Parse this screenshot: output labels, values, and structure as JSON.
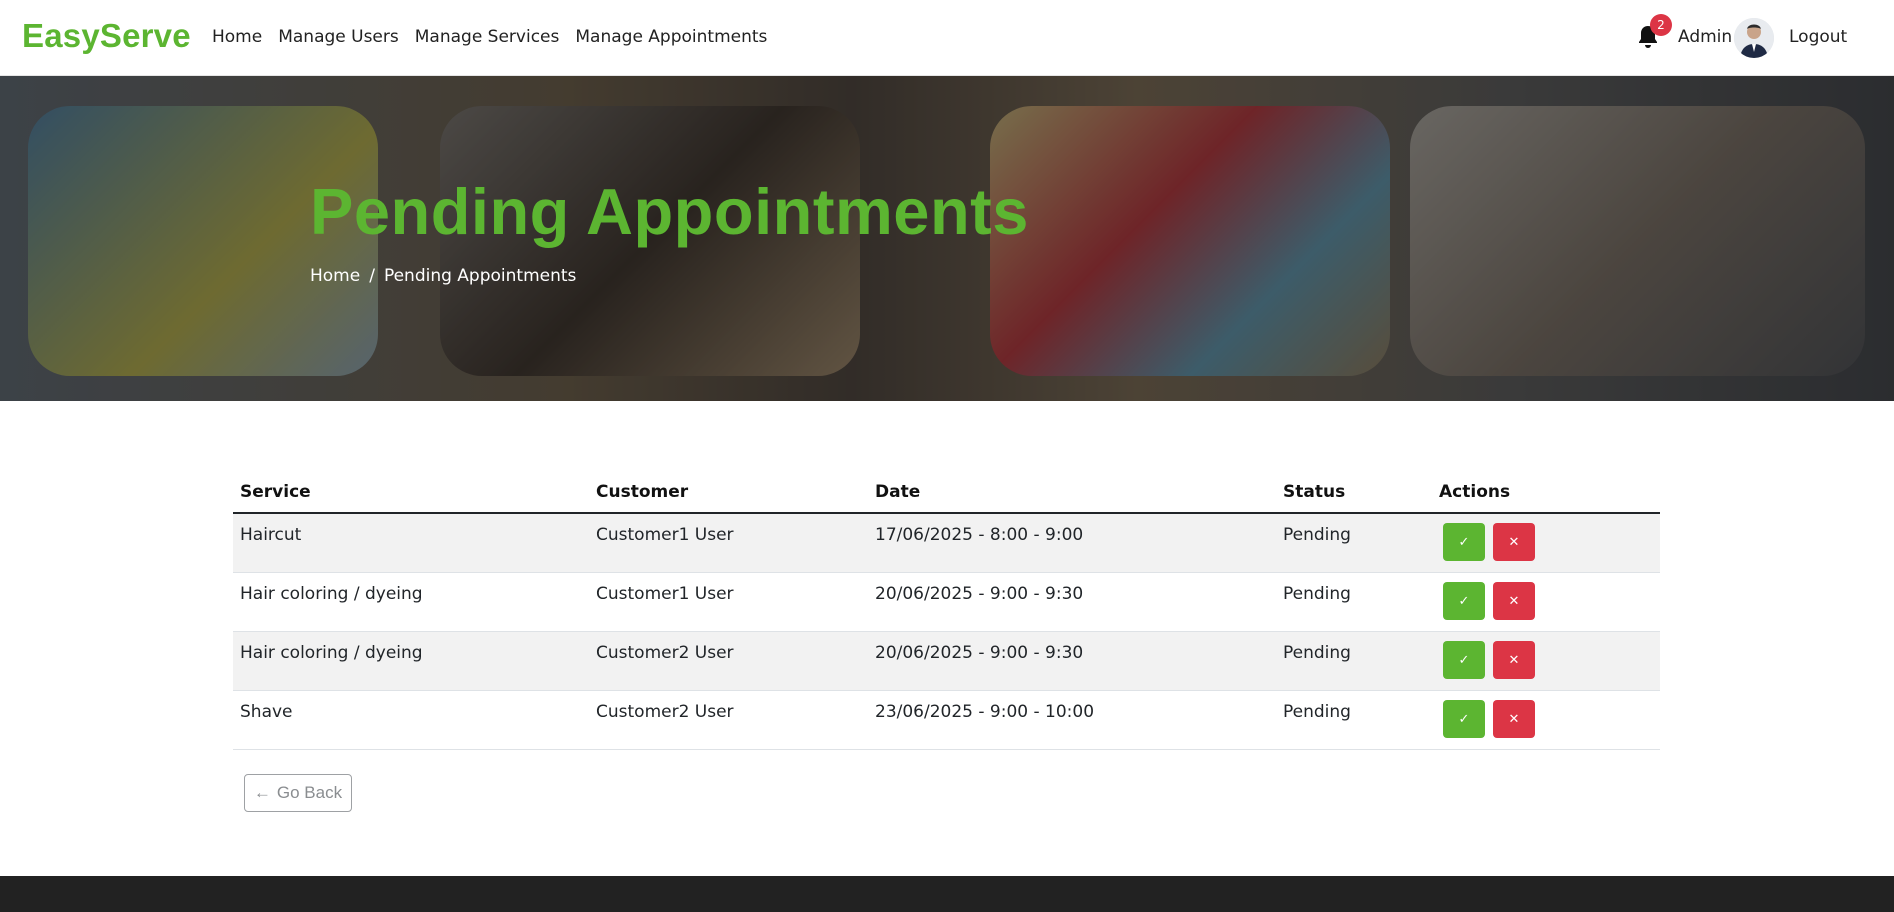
{
  "brand": "EasyServe",
  "nav": {
    "links": [
      "Home",
      "Manage Users",
      "Manage Services",
      "Manage Appointments"
    ],
    "notification_count": "2",
    "user_label": "Admin",
    "logout": "Logout"
  },
  "hero": {
    "title": "Pending Appointments",
    "breadcrumb": {
      "home": "Home",
      "separator": "/",
      "current": "Pending Appointments"
    }
  },
  "table": {
    "headers": [
      "Service",
      "Customer",
      "Date",
      "Status",
      "Actions"
    ],
    "rows": [
      {
        "service": "Haircut",
        "customer": "Customer1 User",
        "date": "17/06/2025 - 8:00 - 9:00",
        "status": "Pending"
      },
      {
        "service": "Hair coloring / dyeing",
        "customer": "Customer1 User",
        "date": "20/06/2025 - 9:00 - 9:30",
        "status": "Pending"
      },
      {
        "service": "Hair coloring / dyeing",
        "customer": "Customer2 User",
        "date": "20/06/2025 - 9:00 - 9:30",
        "status": "Pending"
      },
      {
        "service": "Shave",
        "customer": "Customer2 User",
        "date": "23/06/2025 - 9:00 - 10:00",
        "status": "Pending"
      }
    ],
    "accept_icon": "check-icon",
    "reject_icon": "x-icon"
  },
  "go_back": {
    "arrow": "←",
    "label": "Go Back"
  },
  "colors": {
    "brand": "#5cb531",
    "danger": "#dc3545",
    "footer": "#222222"
  }
}
